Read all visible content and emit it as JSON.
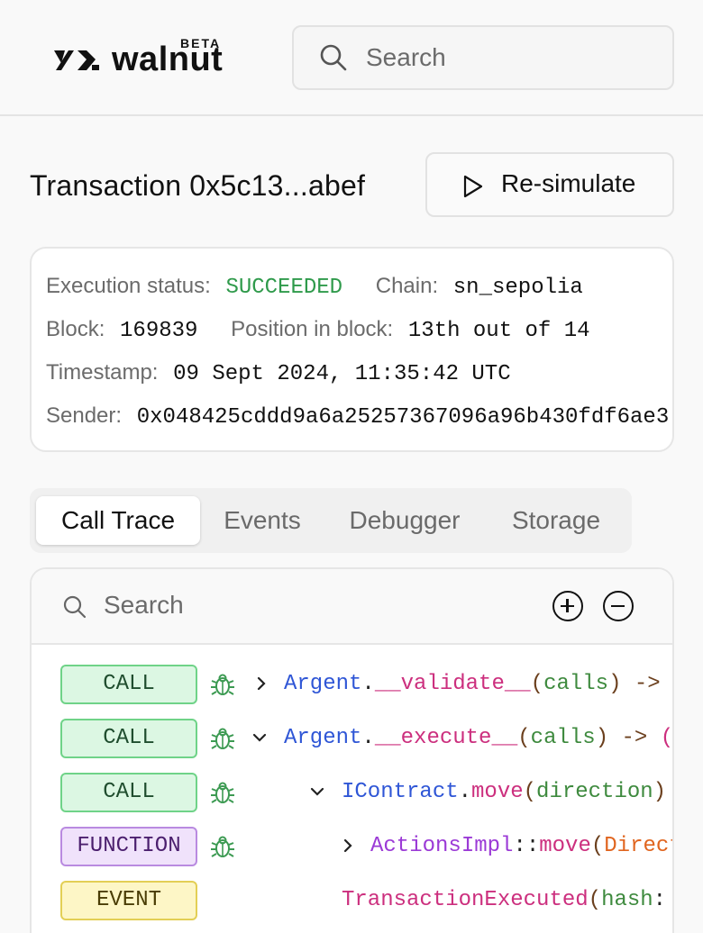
{
  "brand": {
    "name": "walnut",
    "badge": "BETA"
  },
  "top_search": {
    "placeholder": "Search"
  },
  "transaction": {
    "title": "Transaction 0x5c13...abef",
    "resimulate_label": "Re-simulate"
  },
  "info": {
    "execution_status_label": "Execution status:",
    "execution_status_value": "SUCCEEDED",
    "chain_label": "Chain:",
    "chain_value": "sn_sepolia",
    "block_label": "Block:",
    "block_value": "169839",
    "position_label": "Position in block:",
    "position_value": "13th out of 14",
    "timestamp_label": "Timestamp:",
    "timestamp_value": "09 Sept 2024, 11:35:42 UTC",
    "sender_label": "Sender:",
    "sender_value": "0x048425cddd9a6a25257367096a96b430fdf6ae3"
  },
  "tabs": [
    "Call Trace",
    "Events",
    "Debugger",
    "Storage"
  ],
  "trace": {
    "search_placeholder": "Search",
    "rows": [
      {
        "badge": "CALL",
        "expanded": false,
        "parts": [
          "Argent",
          ".",
          "__validate__",
          "(",
          "calls",
          ") ->"
        ]
      },
      {
        "badge": "CALL",
        "expanded": true,
        "parts": [
          "Argent",
          ".",
          "__execute__",
          "(",
          "calls",
          ") ->",
          " ("
        ]
      },
      {
        "badge": "CALL",
        "expanded": true,
        "parts": [
          "IContract",
          ".",
          "move",
          "(",
          "direction",
          ")"
        ]
      },
      {
        "badge": "FUNCTION",
        "expanded": false,
        "parts": [
          "ActionsImpl",
          "::",
          "move",
          "(",
          "Direct"
        ]
      },
      {
        "badge": "EVENT",
        "parts": [
          "TransactionExecuted",
          "(",
          "hash",
          ":"
        ]
      }
    ]
  },
  "icons": {
    "search": "magnifier-icon",
    "play": "play-icon",
    "debug": "bug-icon",
    "expand": "plus-circle-icon",
    "collapse": "minus-circle-icon"
  },
  "colors": {
    "success": "#2f9a4b",
    "call_badge": "#dcf7e3",
    "function_badge": "#f0e2fb",
    "event_badge": "#fdf6c6"
  }
}
